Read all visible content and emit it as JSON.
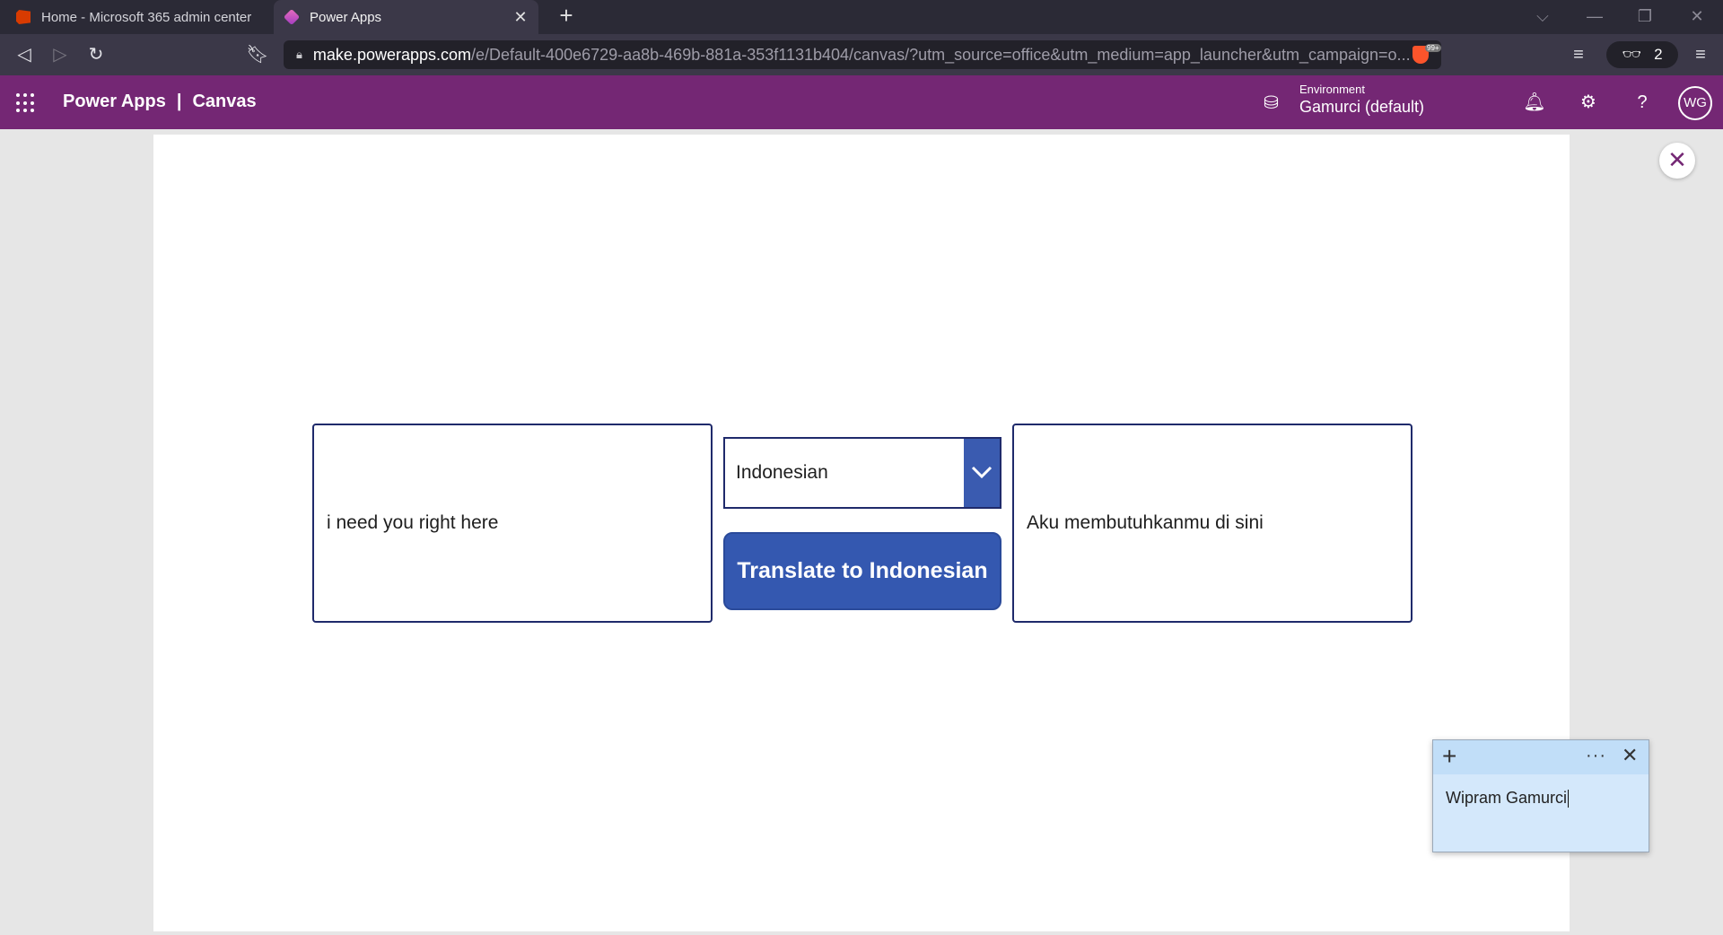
{
  "browser": {
    "tabs": [
      {
        "label": "Home - Microsoft 365 admin center"
      },
      {
        "label": "Power Apps"
      }
    ],
    "url": {
      "host": "make.powerapps.com",
      "path": "/e/Default-400e6729-aa8b-469b-881a-353f1131b404/canvas/?utm_source=office&utm_medium=app_launcher&utm_campaign=o..."
    },
    "brave_badge": "99+",
    "wallet_count": "2"
  },
  "header": {
    "brand": "Power Apps",
    "separator": "|",
    "section": "Canvas",
    "environment_label": "Environment",
    "environment_value": "Gamurci (default)",
    "avatar_initials": "WG"
  },
  "app": {
    "input_text": "i need you right here",
    "language_selected": "Indonesian",
    "translate_button": "Translate to Indonesian",
    "output_text": "Aku membutuhkanmu di sini"
  },
  "sticky_note": {
    "text": "Wipram Gamurci"
  }
}
